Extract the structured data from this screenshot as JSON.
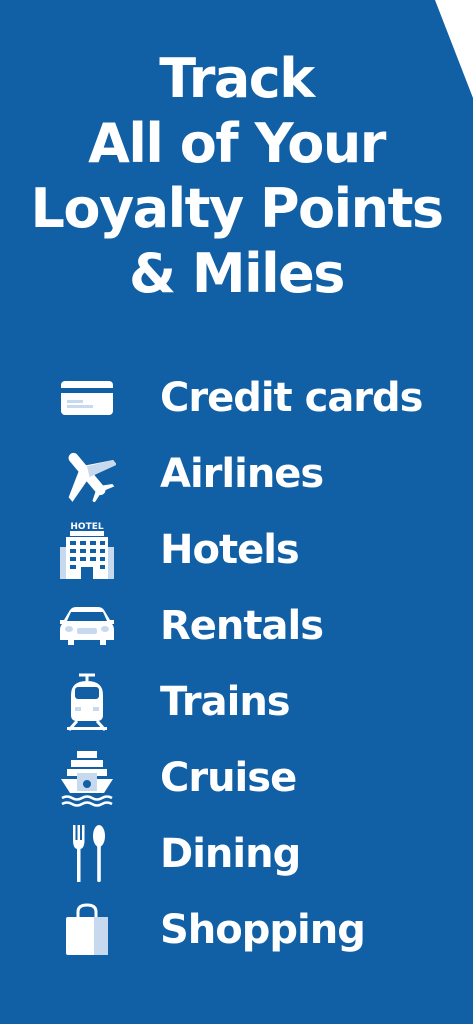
{
  "headline": {
    "line1": "Track",
    "line2": "All of Your",
    "line3": "Loyalty Points",
    "line4": "& Miles"
  },
  "hotel_sign_text": "HOTEL",
  "categories": [
    {
      "label": "Credit cards",
      "icon": "credit-card-icon"
    },
    {
      "label": "Airlines",
      "icon": "airplane-icon"
    },
    {
      "label": "Hotels",
      "icon": "hotel-icon"
    },
    {
      "label": "Rentals",
      "icon": "car-icon"
    },
    {
      "label": "Trains",
      "icon": "train-icon"
    },
    {
      "label": "Cruise",
      "icon": "cruise-ship-icon"
    },
    {
      "label": "Dining",
      "icon": "fork-spoon-icon"
    },
    {
      "label": "Shopping",
      "icon": "shopping-bag-icon"
    }
  ],
  "colors": {
    "background": "#1160a6",
    "text": "#ffffff",
    "icon_accent": "#c7d9ee"
  }
}
